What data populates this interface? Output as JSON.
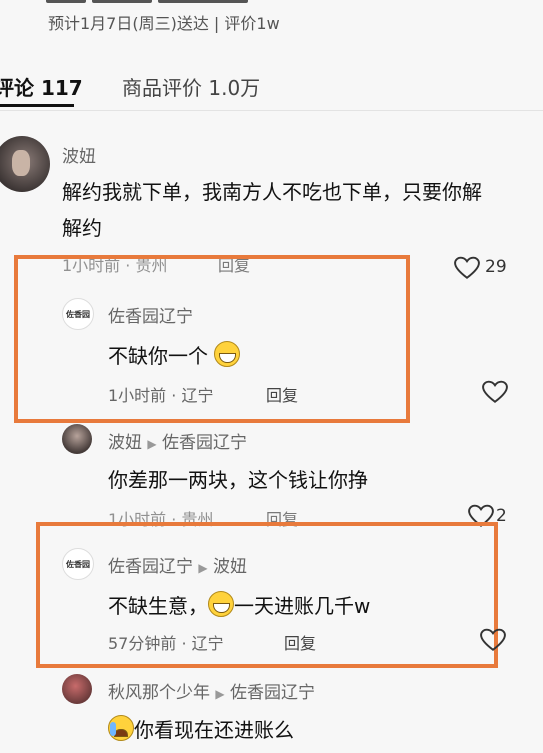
{
  "header": {
    "delivery_text": "预计1月7日(周三)送达 | 评价1w"
  },
  "tabs": [
    {
      "label": "评论 117"
    },
    {
      "label": "商品评价 1.0万"
    }
  ],
  "comment_main": {
    "user": "波妞",
    "text_line1": "解约我就下单，我南方人不吃也下单，只要你解",
    "text_line2": "解约",
    "meta": "1小时前 · 贵州",
    "reply_label": "回复",
    "likes": "29"
  },
  "reply1": {
    "avatar_text": "佐香园",
    "user": "佐香园辽宁",
    "text": "不缺你一个",
    "meta": "1小时前 · 辽宁",
    "reply_label": "回复"
  },
  "reply2": {
    "user": "波妞",
    "reply_to": "佐香园辽宁",
    "text": "你差那一两块，这个钱让你挣",
    "meta": "1小时前 · 贵州",
    "reply_label": "回复",
    "likes": "2"
  },
  "reply3": {
    "avatar_text": "佐香园",
    "user": "佐香园辽宁",
    "reply_to": "波妞",
    "text_before": "不缺生意，",
    "text_after": "一天进账几千w",
    "meta": "57分钟前 · 辽宁",
    "reply_label": "回复"
  },
  "reply4": {
    "user": "秋风那个少年",
    "reply_to": "佐香园辽宁",
    "text": "你看现在还进账么"
  },
  "colors": {
    "highlight_border": "#e87a3c",
    "background": "#f7f7f7"
  }
}
